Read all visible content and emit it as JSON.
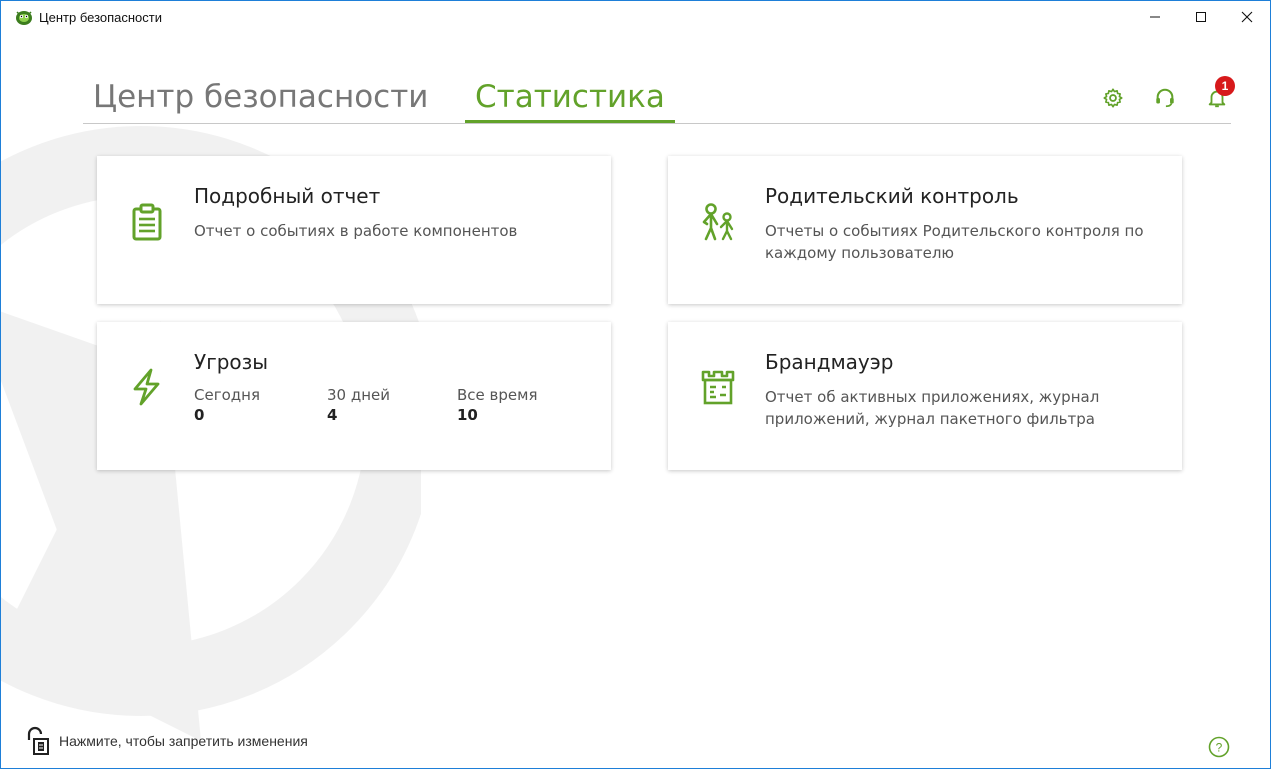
{
  "window": {
    "title": "Центр безопасности",
    "controls": [
      "minimize",
      "maximize",
      "close"
    ]
  },
  "tabs": [
    {
      "label": "Центр безопасности",
      "active": false
    },
    {
      "label": "Статистика",
      "active": true
    }
  ],
  "header_icons": {
    "settings": "gear-icon",
    "support": "headset-icon",
    "notifications": "bell-icon",
    "notification_count": "1"
  },
  "cards": {
    "report": {
      "title": "Подробный отчет",
      "description": "Отчет о событиях в работе компонентов",
      "icon": "clipboard-icon"
    },
    "parental": {
      "title": "Родительский контроль",
      "description": "Отчеты о событиях Родительского контроля по каждому пользователю",
      "icon": "parent-child-icon"
    },
    "threats": {
      "title": "Угрозы",
      "icon": "lightning-icon",
      "stats": [
        {
          "label": "Сегодня",
          "value": "0"
        },
        {
          "label": "30 дней",
          "value": "4"
        },
        {
          "label": "Все время",
          "value": "10"
        }
      ]
    },
    "firewall": {
      "title": "Брандмауэр",
      "description": "Отчет об активных приложениях, журнал приложений, журнал пакетного фильтра",
      "icon": "castle-icon"
    }
  },
  "footer": {
    "lock_text": "Нажмите, чтобы запретить изменения",
    "help_icon": "help-icon"
  },
  "colors": {
    "accent": "#62a22a",
    "badge": "#d7191b",
    "window_border": "#1e7fd8"
  }
}
